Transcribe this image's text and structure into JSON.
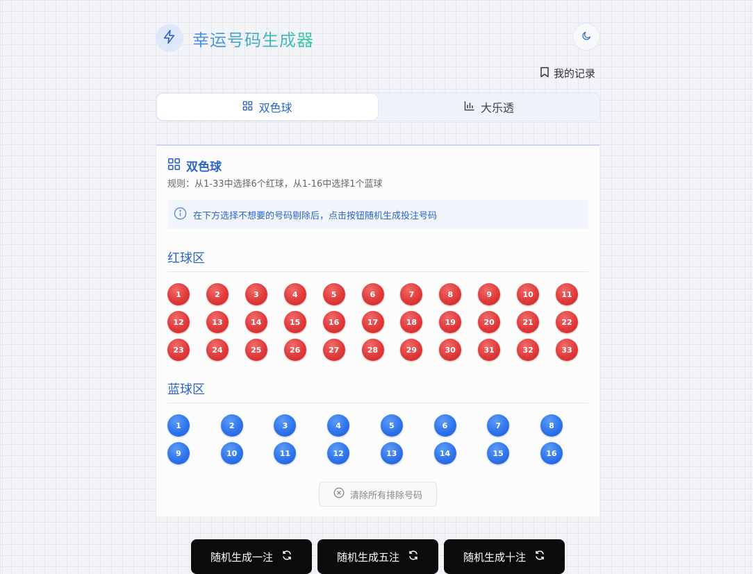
{
  "header": {
    "title": "幸运号码生成器",
    "records_label": "我的记录"
  },
  "tabs": [
    {
      "label": "双色球",
      "active": true
    },
    {
      "label": "大乐透",
      "active": false
    }
  ],
  "card": {
    "title": "双色球",
    "rule": "规则：从1-33中选择6个红球，从1-16中选择1个蓝球",
    "info": "在下方选择不想要的号码剔除后，点击按钮随机生成投注号码",
    "red_section_title": "红球区",
    "blue_section_title": "蓝球区",
    "red_balls": [
      "1",
      "2",
      "3",
      "4",
      "5",
      "6",
      "7",
      "8",
      "9",
      "10",
      "11",
      "12",
      "13",
      "14",
      "15",
      "16",
      "17",
      "18",
      "19",
      "20",
      "21",
      "22",
      "23",
      "24",
      "25",
      "26",
      "27",
      "28",
      "29",
      "30",
      "31",
      "32",
      "33"
    ],
    "blue_balls": [
      "1",
      "2",
      "3",
      "4",
      "5",
      "6",
      "7",
      "8",
      "9",
      "10",
      "11",
      "12",
      "13",
      "14",
      "15",
      "16"
    ],
    "clear_label": "清除所有排除号码"
  },
  "actions": [
    {
      "label": "随机生成一注"
    },
    {
      "label": "随机生成五注"
    },
    {
      "label": "随机生成十注"
    }
  ],
  "colors": {
    "accent": "#2d64c8",
    "red_ball": "#e03a3a",
    "blue_ball": "#2f74ec",
    "button_bg": "#0b0b0c"
  },
  "icons": {
    "logo": "lightning-icon",
    "theme": "moon-icon",
    "records": "bookmark-icon",
    "tab1": "grid-icon",
    "tab2": "bar-chart-icon",
    "info": "info-icon",
    "clear": "close-circle-icon",
    "refresh": "refresh-icon"
  }
}
